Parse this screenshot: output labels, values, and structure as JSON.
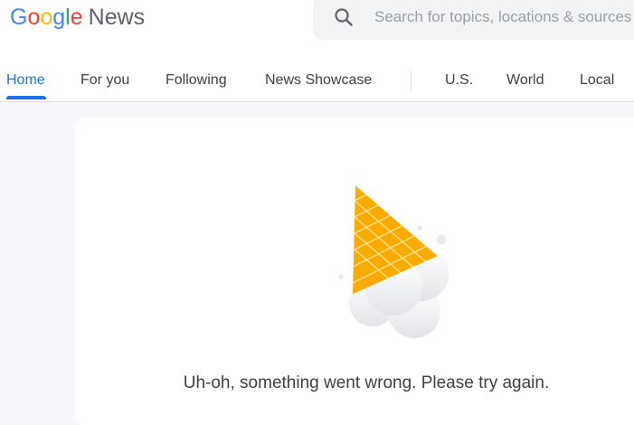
{
  "app": {
    "logo_letters": [
      "G",
      "o",
      "o",
      "g",
      "l",
      "e"
    ],
    "logo_suffix": "News"
  },
  "search": {
    "placeholder": "Search for topics, locations & sources",
    "icon": "search-icon"
  },
  "tabs": [
    {
      "label": "Home",
      "active": true
    },
    {
      "label": "For you",
      "active": false
    },
    {
      "label": "Following",
      "active": false
    },
    {
      "label": "News Showcase",
      "active": false
    },
    {
      "label": "U.S.",
      "active": false
    },
    {
      "label": "World",
      "active": false
    },
    {
      "label": "Local",
      "active": false
    }
  ],
  "error": {
    "message": "Uh-oh, something went wrong. Please try again.",
    "illustration": "dropped-ice-cream-cone"
  },
  "colors": {
    "accent": "#1a73e8",
    "cone": "#f9ab00",
    "cone_highlight": "#fbbc04"
  }
}
